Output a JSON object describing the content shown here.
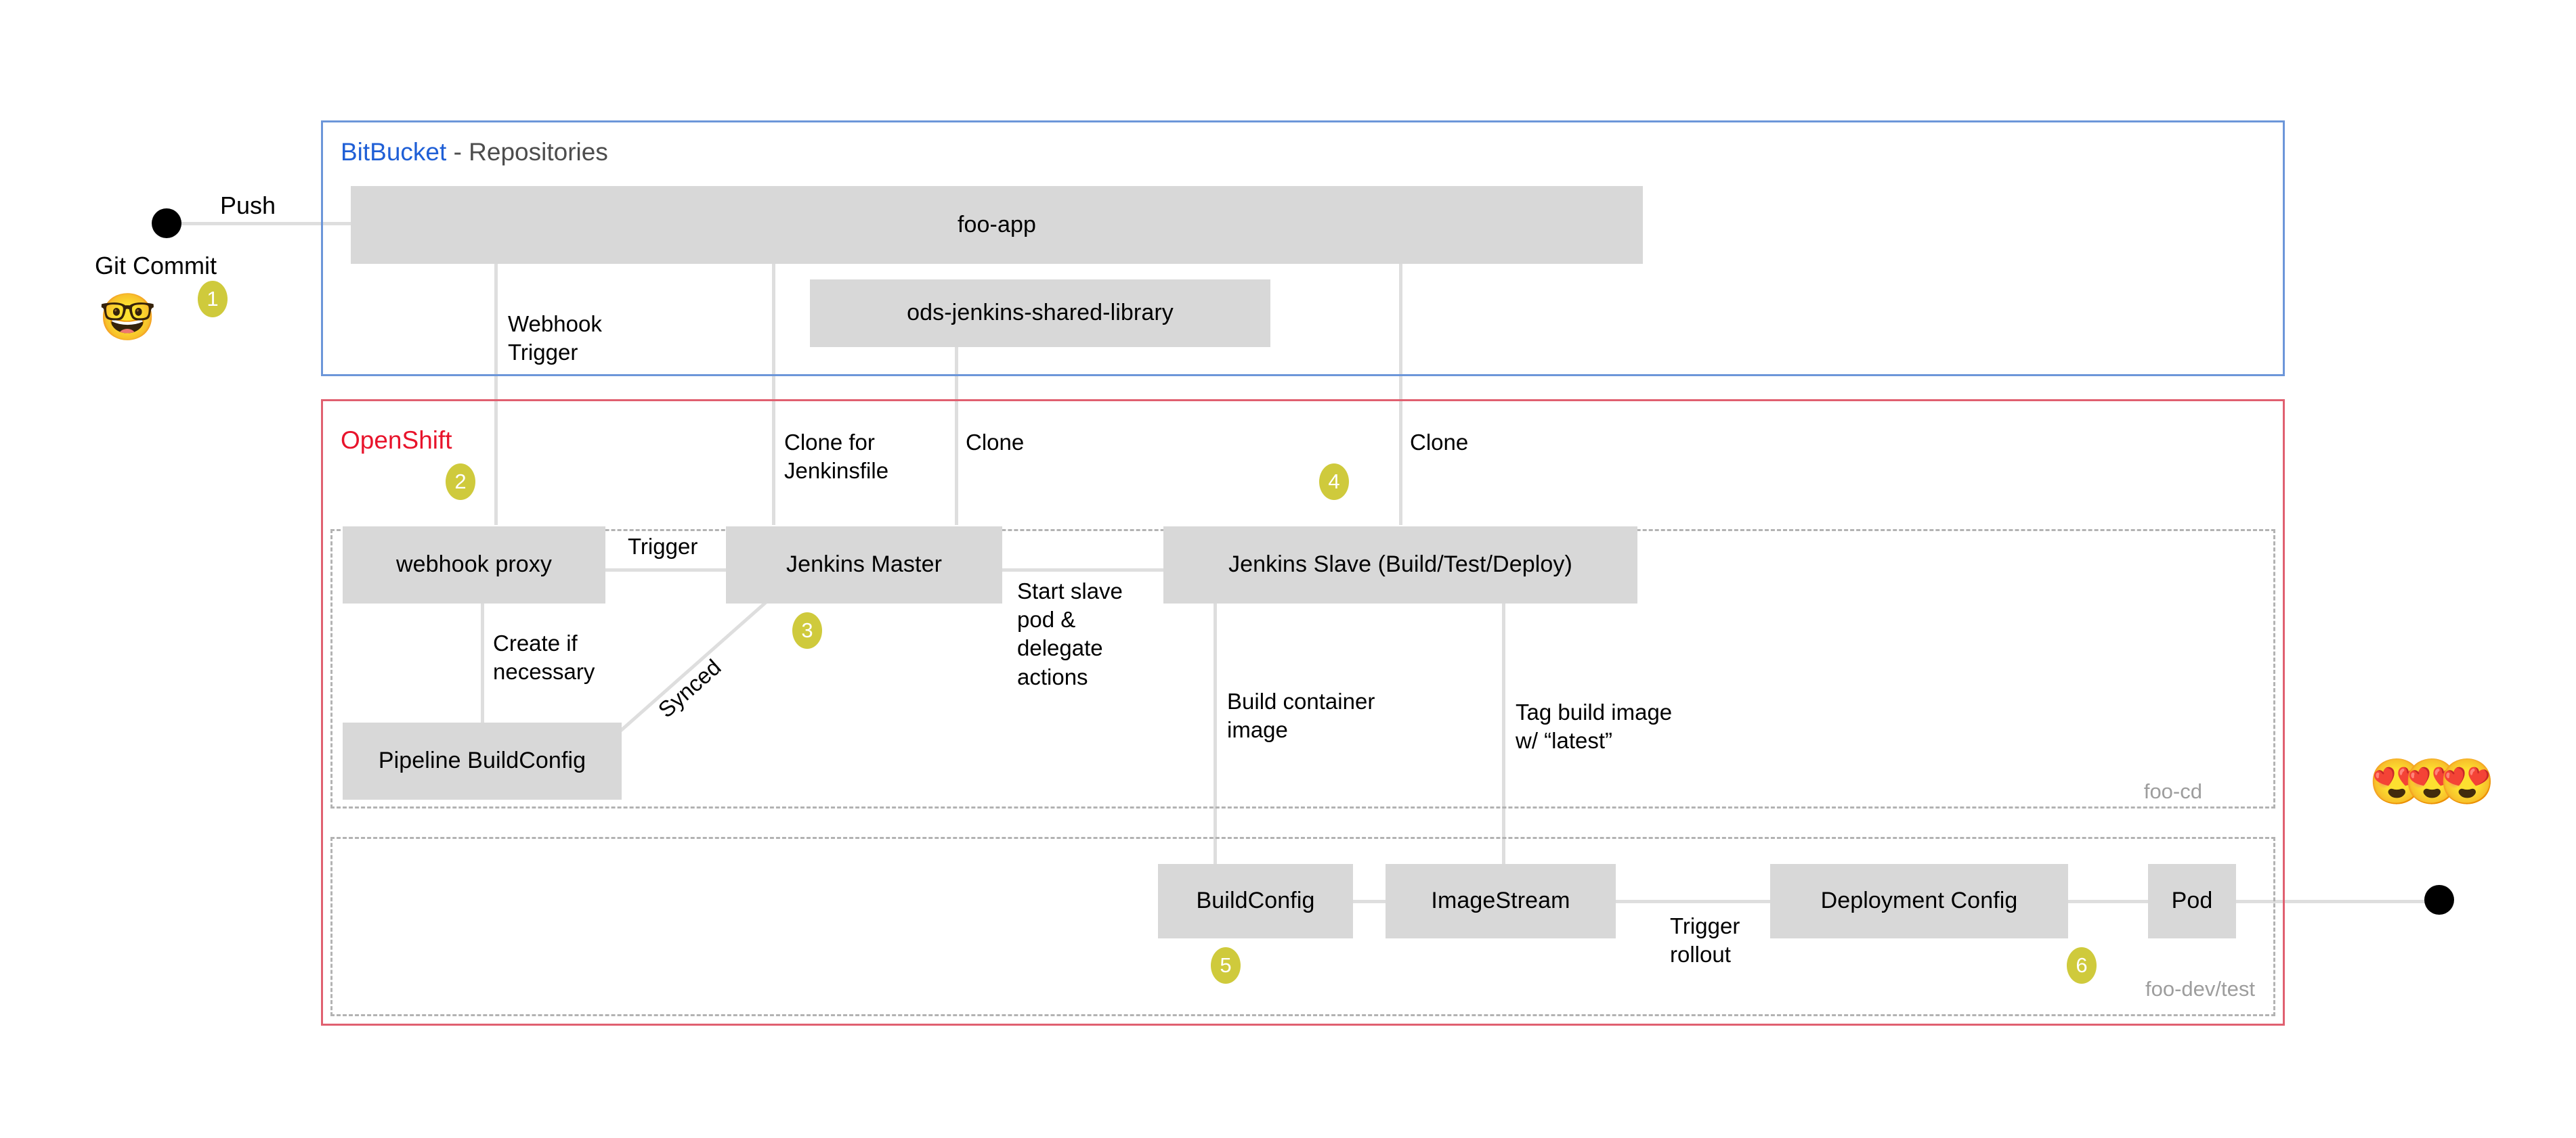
{
  "diagram": {
    "title_bitbucket_brand": "BitBucket",
    "title_bitbucket_rest": " - Repositories",
    "title_openshift": "OpenShift"
  },
  "actors": {
    "git_commit_label": "Git Commit",
    "git_commit_emoji": "🤓",
    "push_label": "Push",
    "happy_users_emoji": "😍😍😍"
  },
  "nodes": {
    "foo_app": "foo-app",
    "shared_library": "ods-jenkins-shared-library",
    "webhook_proxy": "webhook proxy",
    "jenkins_master": "Jenkins Master",
    "jenkins_slave": "Jenkins Slave (Build/Test/Deploy)",
    "pipeline_buildconfig": "Pipeline BuildConfig",
    "buildconfig": "BuildConfig",
    "imagestream": "ImageStream",
    "deployment_config": "Deployment Config",
    "pod": "Pod"
  },
  "edge_labels": {
    "webhook_trigger": "Webhook\nTrigger",
    "clone_for_jenkinsfile": "Clone for\nJenkinsfile",
    "clone_a": "Clone",
    "clone_b": "Clone",
    "trigger_master": "Trigger",
    "create_if_necessary": "Create if\nnecessary",
    "synced": "Synced",
    "start_slave": "Start slave\npod &\ndelegate\nactions",
    "build_container_image": "Build container\nimage",
    "tag_build_image": "Tag build image\nw/ “latest”",
    "trigger_rollout": "Trigger\nrollout"
  },
  "namespaces": {
    "foo_cd": "foo-cd",
    "foo_dev_test": "foo-dev/test"
  },
  "steps": [
    {
      "number": "1"
    },
    {
      "number": "2"
    },
    {
      "number": "3"
    },
    {
      "number": "4"
    },
    {
      "number": "5"
    },
    {
      "number": "6"
    }
  ],
  "colors": {
    "bitbucket_border": "#6c96d9",
    "bitbucket_brand_text": "#1f5fd6",
    "openshift_border": "#e06070",
    "openshift_brand_text": "#e8132b",
    "node_fill": "#d8d8d8",
    "connector": "#dedede",
    "badge_fill": "#cfca3c",
    "namespace_text": "#9d9d9d",
    "dashed_border": "#b3b3b3"
  }
}
